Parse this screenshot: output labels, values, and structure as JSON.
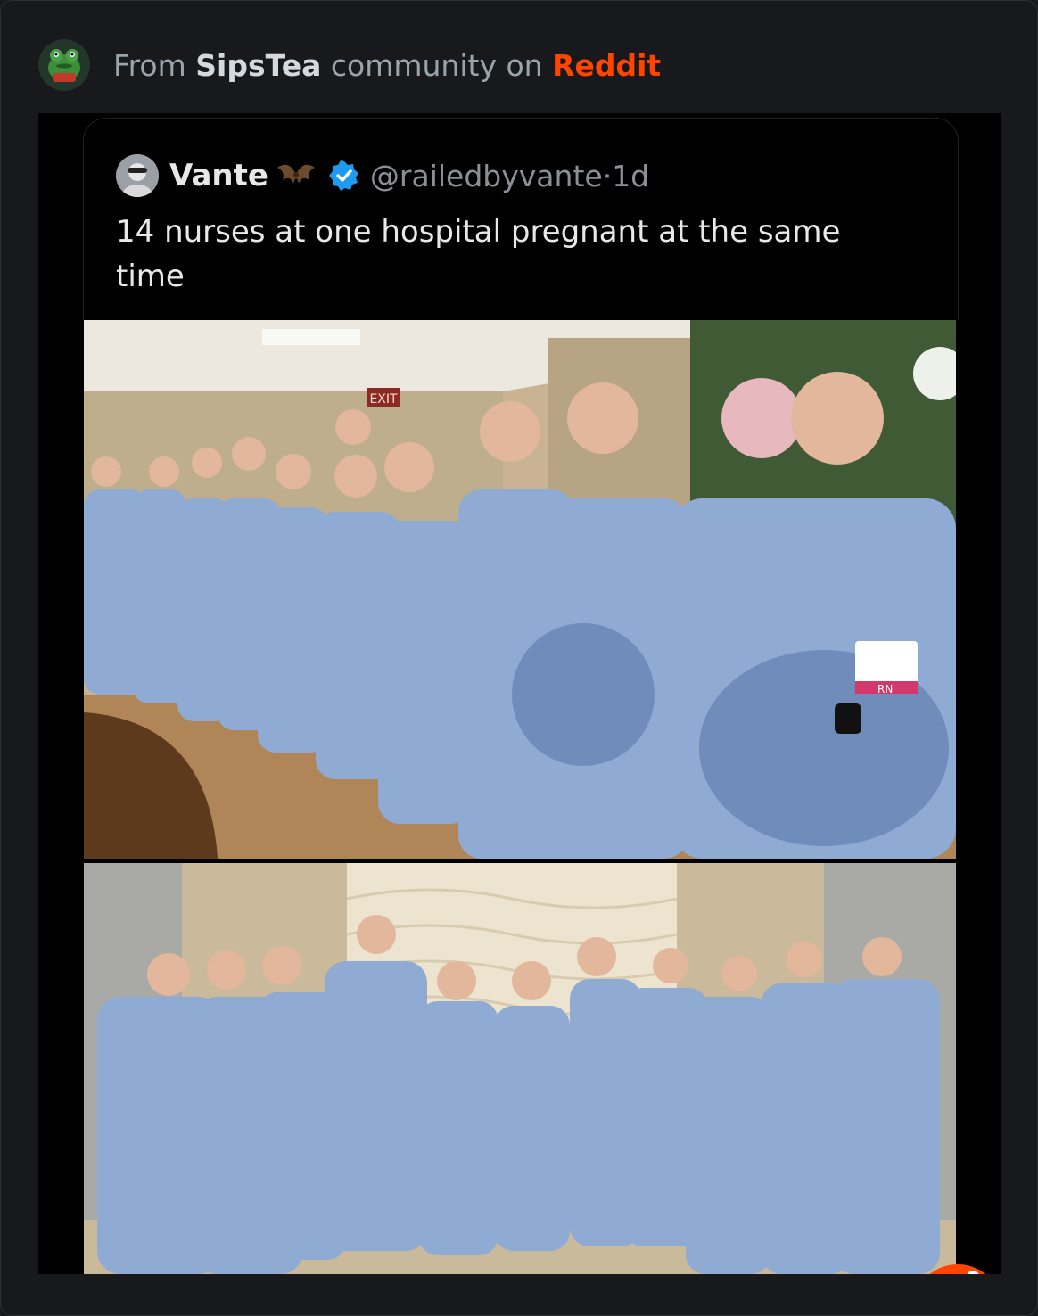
{
  "header": {
    "prefix": "From",
    "community": "SipsTea",
    "middle": "community on",
    "platform": "Reddit",
    "avatar_icon": "frog-avatar-icon"
  },
  "tweet": {
    "name": "Vante",
    "name_emoji": "bat-icon",
    "verified": true,
    "handle": "@railedbyvante",
    "separator": "·",
    "age": "1d",
    "text": "14 nurses at one hospital pregnant at the same time"
  },
  "photos": [
    {
      "label": "top-photo",
      "sign_text": "EXIT",
      "badge_text": "RN"
    },
    {
      "label": "bottom-photo"
    }
  ],
  "watermark_icon": "reddit-snoo-icon",
  "colors": {
    "background": "#17191c",
    "reddit_orange": "#ff4500",
    "verified_blue": "#1d9bf0",
    "scrubs_blue": "#8aa6cf"
  }
}
